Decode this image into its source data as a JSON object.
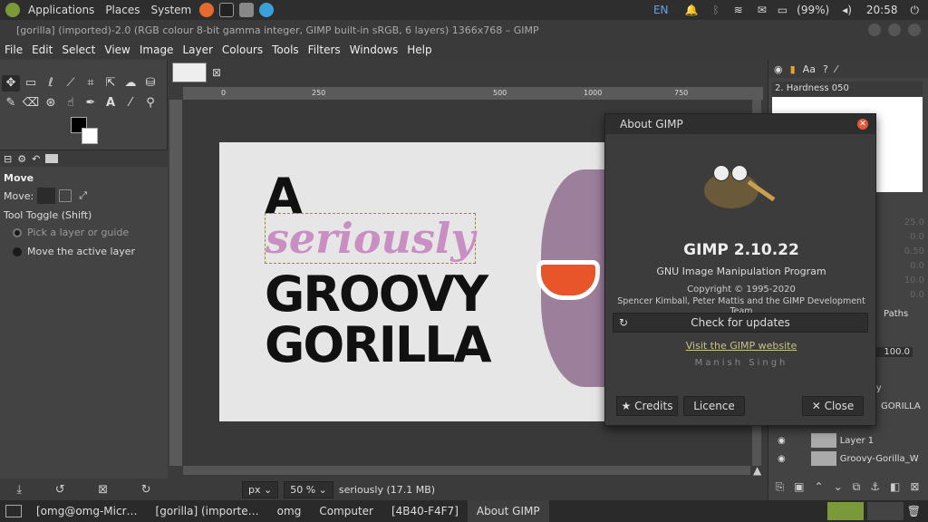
{
  "topbar": {
    "applications": "Applications",
    "places": "Places",
    "system": "System",
    "lang": "EN",
    "battery": "(99%)",
    "clock": "20:58"
  },
  "window": {
    "title": "[gorilla] (imported)-2.0 (RGB colour 8-bit gamma integer, GIMP built-in sRGB, 6 layers) 1366x768 – GIMP"
  },
  "menu": [
    "File",
    "Edit",
    "Select",
    "View",
    "Image",
    "Layer",
    "Colours",
    "Tools",
    "Filters",
    "Windows",
    "Help"
  ],
  "tool_options": {
    "title": "Move",
    "move_label": "Move:",
    "toggle": "Tool Toggle  (Shift)",
    "opt1": "Pick a layer or guide",
    "opt2": "Move the active layer"
  },
  "ruler": {
    "t0": "0",
    "t250": "250",
    "t500": "500",
    "t750": "750",
    "t1000": "1000"
  },
  "artwork": {
    "a": "A",
    "seriously": "seriously",
    "groovy": "GROOVY",
    "gorilla": "GORILLA"
  },
  "status": {
    "unit": "px",
    "zoom": "50 %",
    "info": "seriously (17.1 MB)"
  },
  "brush": {
    "name": "2. Hardness 050"
  },
  "dock": {
    "paths_tab": "Paths",
    "opacity": "100.0",
    "fields": [
      "25.0",
      "0.0",
      "0.50",
      "0.0",
      "10.0",
      "0.0"
    ]
  },
  "layers": [
    {
      "name": "ly"
    },
    {
      "name": "GORILLA"
    },
    {
      "name": "Layer 1"
    },
    {
      "name": "Groovy-Gorilla_W"
    }
  ],
  "about": {
    "title": "About GIMP",
    "name": "GIMP 2.10.22",
    "subtitle": "GNU Image Manipulation Program",
    "copyright": "Copyright © 1995-2020",
    "authors": "Spencer Kimball, Peter Mattis and the GIMP Development Team",
    "check_updates": "Check for updates",
    "website": "Visit the GIMP website",
    "credits_name": "Manish Singh",
    "credits": "Credits",
    "licence": "Licence",
    "close": "Close"
  },
  "taskbar": [
    "[omg@omg-Micr…",
    "[gorilla] (importe…",
    "omg",
    "Computer",
    "[4B40-F4F7]",
    "About GIMP"
  ],
  "colors": {
    "accent_purple": "#c98fc2",
    "dialog_close": "#e2583a",
    "link": "#c9c28a"
  }
}
